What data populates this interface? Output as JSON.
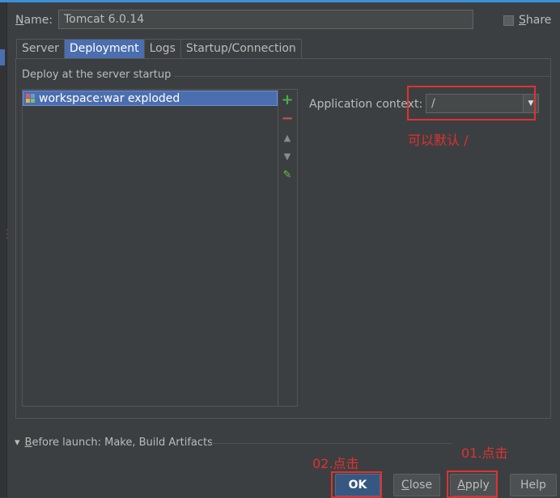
{
  "dialog": {
    "name_label_u": "N",
    "name_label_rest": "ame:",
    "name_value": "Tomcat 6.0.14",
    "share_label_u": "S",
    "share_label_rest": "hare",
    "share_checked": false
  },
  "tabs": [
    {
      "label": "Server",
      "active": false
    },
    {
      "label": "Deployment",
      "active": true
    },
    {
      "label": "Logs",
      "active": false
    },
    {
      "label": "Startup/Connection",
      "active": false
    }
  ],
  "deploy": {
    "group_title": "Deploy at the server startup",
    "items": [
      {
        "label": "workspace:war exploded",
        "selected": true,
        "icon": "artifact-icon"
      }
    ],
    "toolbar": [
      {
        "name": "add-icon",
        "glyph": "+"
      },
      {
        "name": "remove-icon",
        "glyph": "−"
      },
      {
        "name": "move-up-icon",
        "glyph": "▲"
      },
      {
        "name": "move-down-icon",
        "glyph": "▼"
      },
      {
        "name": "edit-icon",
        "glyph": "✎"
      }
    ]
  },
  "context": {
    "label": "Application context:",
    "value": "/",
    "arrow": "▼"
  },
  "annotations": {
    "context_note": "可以默认 /",
    "ok_note": "02.点击",
    "apply_note": "01.点击"
  },
  "before_launch": {
    "arrow": "▾",
    "label_u": "B",
    "label_rest": "efore launch: Make, Build Artifacts"
  },
  "buttons": {
    "ok": "OK",
    "close_u": "C",
    "close_rest": "lose",
    "apply_u": "A",
    "apply_rest": "pply",
    "help": "Help"
  },
  "colors": {
    "background": "#3c3f41",
    "selection": "#4b6eaf",
    "annotation_red": "#e03131",
    "default_button": "#365880"
  }
}
